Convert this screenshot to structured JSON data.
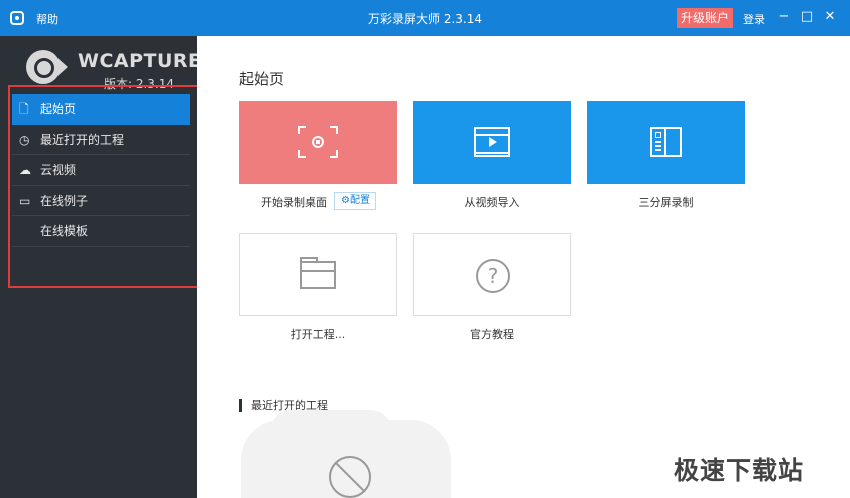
{
  "titlebar": {
    "help_label": "帮助",
    "title": "万彩录屏大师 2.3.14",
    "upgrade_label": "升级账户",
    "login_label": "登录",
    "minimize": "−",
    "maximize": "□",
    "close": "✕",
    "upgrade_color": "#f26b6b",
    "bar_color": "#1681d9"
  },
  "sidebar": {
    "logo_text": "WCAPTURE",
    "version": "版本: 2.3.14",
    "items": [
      {
        "label": "起始页",
        "icon": "document-icon",
        "glyph": "🗋",
        "active": true
      },
      {
        "label": "最近打开的工程",
        "icon": "clock-icon",
        "glyph": "◷"
      },
      {
        "label": "云视频",
        "icon": "cloud-icon",
        "glyph": "☁"
      },
      {
        "label": "在线例子",
        "icon": "briefcase-icon",
        "glyph": "▭"
      },
      {
        "label": "在线模板",
        "icon": "",
        "glyph": ""
      }
    ]
  },
  "main": {
    "page_title": "起始页",
    "tiles": [
      {
        "label": "开始录制桌面",
        "icon": "record-screen-icon"
      },
      {
        "label": "从视频导入",
        "icon": "film-icon"
      },
      {
        "label": "三分屏录制",
        "icon": "split-screen-icon"
      },
      {
        "label": "打开工程...",
        "icon": "folder-icon"
      },
      {
        "label": "官方教程",
        "icon": "help-icon",
        "glyph": "?"
      }
    ],
    "config_label": "⚙配置",
    "recent_heading": "最近打开的工程"
  },
  "watermark": "极速下载站"
}
